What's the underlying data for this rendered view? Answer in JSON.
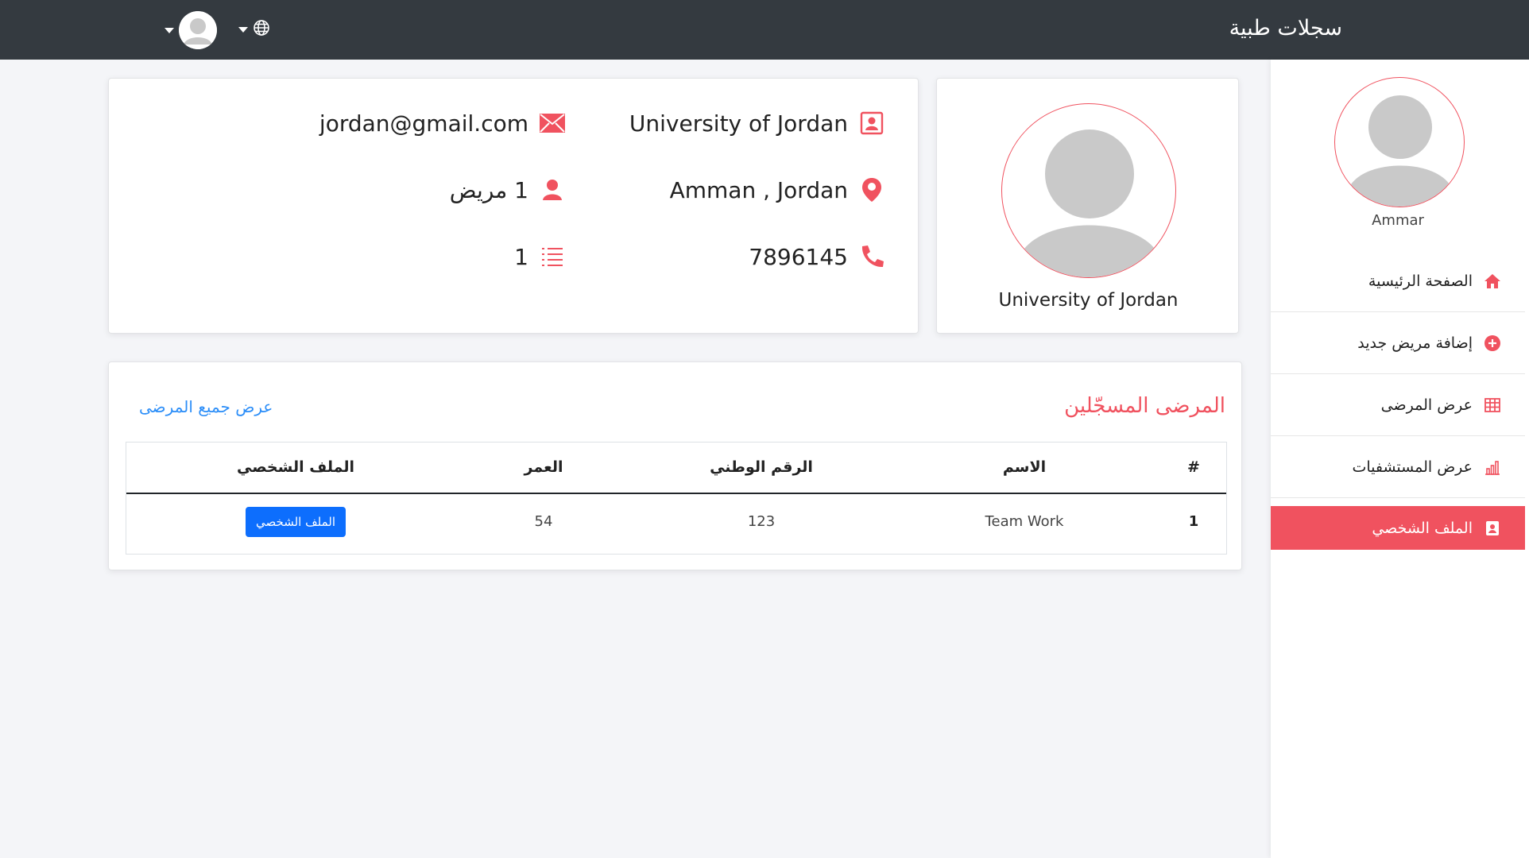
{
  "app": {
    "brand": "سجلات طبية"
  },
  "topbar": {
    "language_icon": "globe-icon",
    "user_icon": "user-avatar"
  },
  "sidebar": {
    "user_name": "Ammar",
    "items": [
      {
        "label": "الصفحة الرئيسية",
        "icon": "home-icon",
        "active": false
      },
      {
        "label": "إضافة مريض جديد",
        "icon": "plus-circle-icon",
        "active": false
      },
      {
        "label": "عرض المرضى",
        "icon": "table-icon",
        "active": false
      },
      {
        "label": "عرض المستشفيات",
        "icon": "chart-icon",
        "active": false
      },
      {
        "label": "الملف الشخصي",
        "icon": "profile-card-icon",
        "active": true
      }
    ]
  },
  "profile": {
    "name": "University of Jordan"
  },
  "info": {
    "org_name": "University of Jordan",
    "email": "jordan@gmail.com",
    "location": "Amman , Jordan",
    "patients": "1 مريض",
    "phone": "7896145",
    "records": "1"
  },
  "patients_table": {
    "title": "المرضى المسجّلين",
    "view_all": "عرض جميع المرضى",
    "headers": [
      "#",
      "الاسم",
      "الرقم الوطني",
      "العمر",
      "الملف الشخصي"
    ],
    "rows": [
      {
        "index": "1",
        "name": "Team Work",
        "national_id": "123",
        "age": "54",
        "action": "الملف الشخصي"
      }
    ]
  },
  "colors": {
    "accent": "#f0525f",
    "topbar": "#343a40",
    "primary_button": "#0d6efd",
    "link": "#2c8ef8"
  }
}
